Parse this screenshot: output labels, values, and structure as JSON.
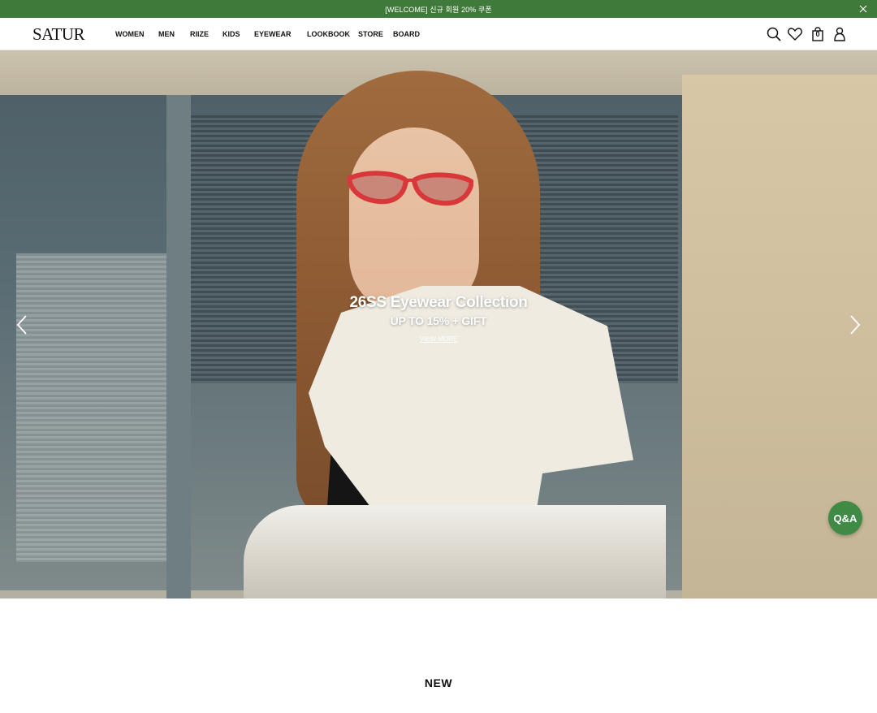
{
  "announcement": {
    "text": "[WELCOME] 신규 회원 20% 쿠폰",
    "background": "#3f7a3a"
  },
  "header": {
    "logo": "SATUR",
    "nav": [
      "WOMEN",
      "MEN",
      "RIIZE",
      "KIDS",
      "EYEWEAR",
      "LOOKBOOK",
      "STORE",
      "BOARD"
    ],
    "icons": [
      "search-icon",
      "heart-icon",
      "cart-icon",
      "user-icon"
    ],
    "cart_count": "0"
  },
  "hero": {
    "title": "26SS Eyewear Collection",
    "subtitle": "UP TO 15% + GIFT",
    "link": "VIEW MORE"
  },
  "floating": {
    "qa_label": "Q&A",
    "color": "#3f8a45"
  },
  "section": {
    "title": "NEW"
  }
}
